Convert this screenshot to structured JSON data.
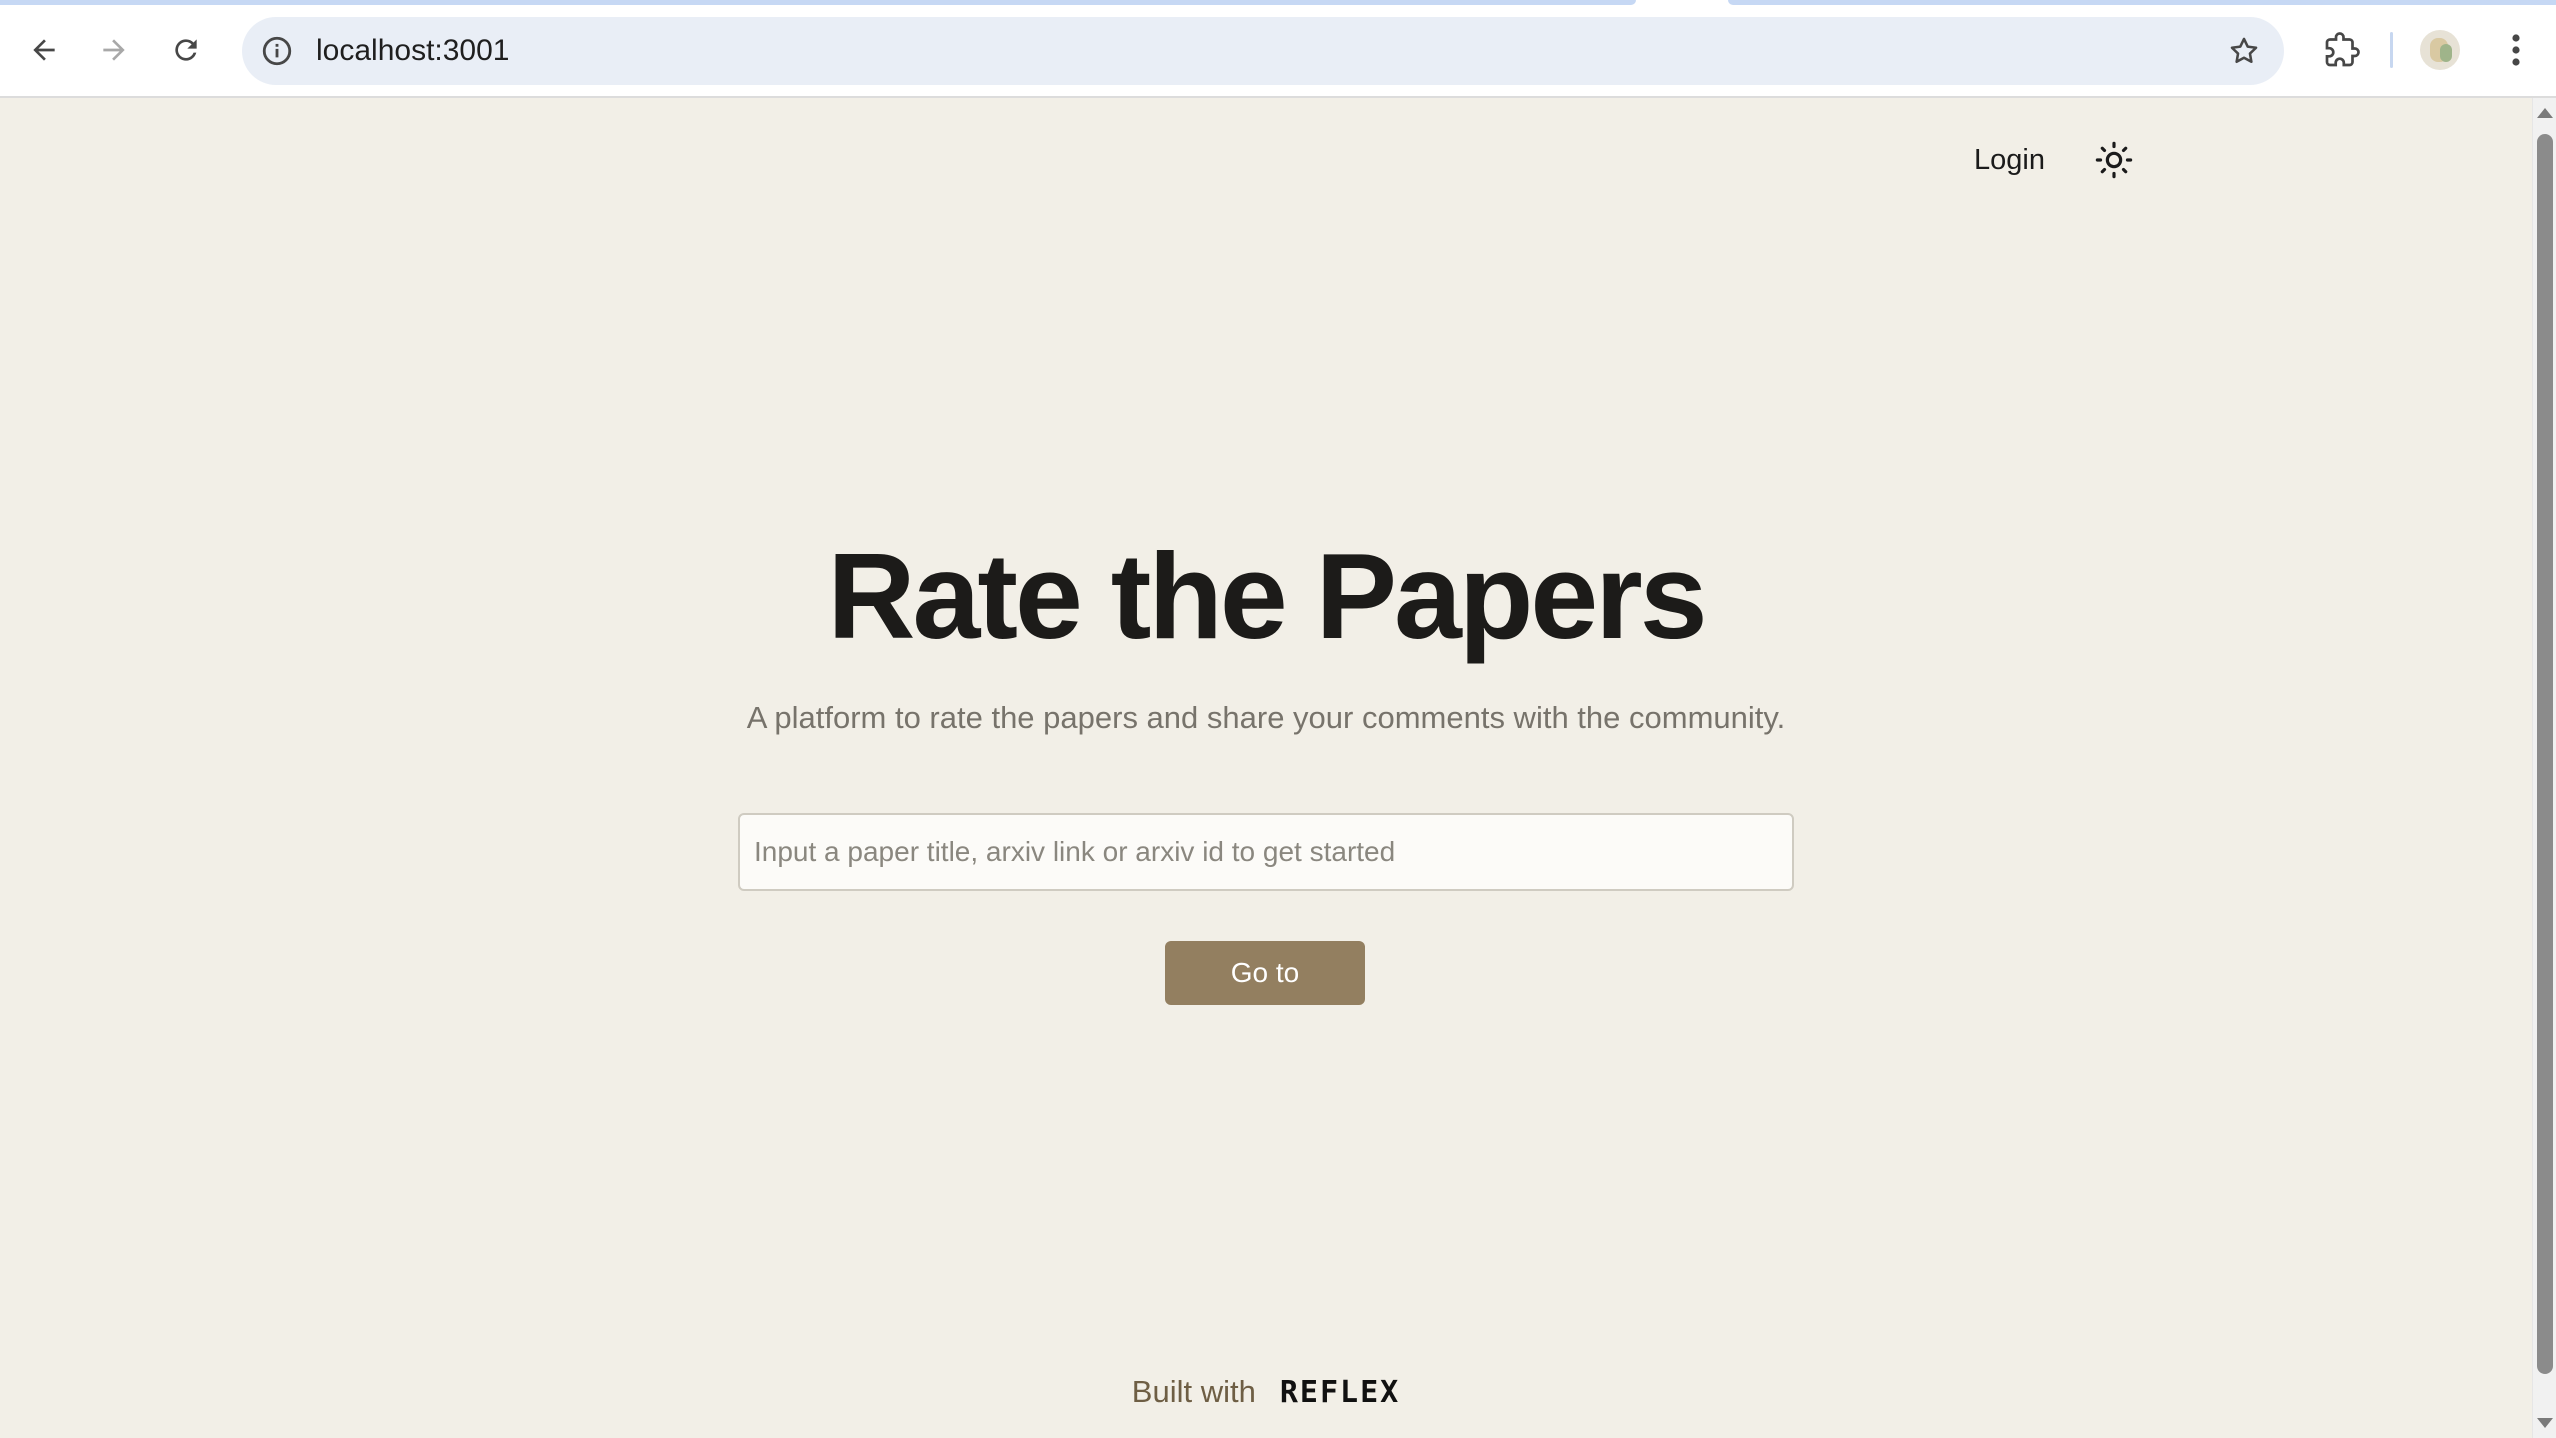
{
  "browser": {
    "url": "localhost:3001"
  },
  "header": {
    "login_label": "Login"
  },
  "hero": {
    "title": "Rate the Papers",
    "subtitle": "A platform to rate the papers and share your comments with the community."
  },
  "search": {
    "placeholder": "Input a paper title, arxiv link or arxiv id to get started",
    "value": "",
    "button_label": "Go to"
  },
  "footer": {
    "built_with": "Built with",
    "brand": "REFLEX"
  },
  "colors": {
    "page_background": "#f2efe7",
    "button_background": "#937f60",
    "title_text": "#1c1b19",
    "subtitle_text": "#77736b"
  }
}
